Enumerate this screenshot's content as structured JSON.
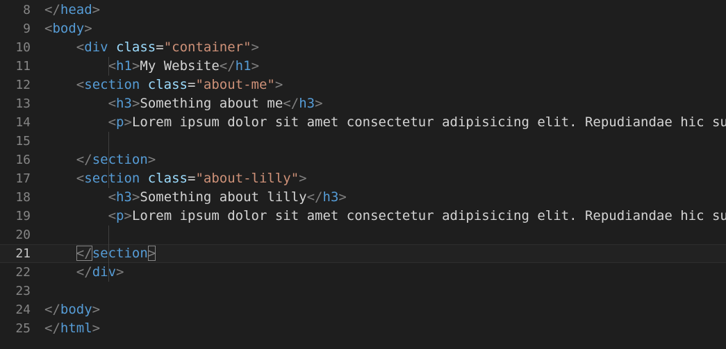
{
  "editor": {
    "language": "html",
    "current_line": 21,
    "colors": {
      "background": "#1e1e1e",
      "line_number": "#858585",
      "punctuation": "#808080",
      "tag": "#569cd6",
      "attribute": "#9cdcfe",
      "string": "#ce9178",
      "text": "#d4d4d4"
    },
    "lines": [
      {
        "n": "8",
        "indent": 0,
        "tokens": [
          {
            "t": "punct",
            "v": "</"
          },
          {
            "t": "tag",
            "v": "head"
          },
          {
            "t": "punct",
            "v": ">"
          }
        ]
      },
      {
        "n": "9",
        "indent": 0,
        "tokens": [
          {
            "t": "punct",
            "v": "<"
          },
          {
            "t": "tag",
            "v": "body"
          },
          {
            "t": "punct",
            "v": ">"
          }
        ]
      },
      {
        "n": "10",
        "indent": 4,
        "tokens": [
          {
            "t": "punct",
            "v": "<"
          },
          {
            "t": "tag",
            "v": "div"
          },
          {
            "t": "text",
            "v": " "
          },
          {
            "t": "attr",
            "v": "class"
          },
          {
            "t": "text",
            "v": "="
          },
          {
            "t": "str",
            "v": "\"container\""
          },
          {
            "t": "punct",
            "v": ">"
          }
        ]
      },
      {
        "n": "11",
        "indent": 8,
        "tokens": [
          {
            "t": "punct",
            "v": "<"
          },
          {
            "t": "tag",
            "v": "h1"
          },
          {
            "t": "punct",
            "v": ">"
          },
          {
            "t": "text",
            "v": "My Website"
          },
          {
            "t": "punct",
            "v": "</"
          },
          {
            "t": "tag",
            "v": "h1"
          },
          {
            "t": "punct",
            "v": ">"
          }
        ]
      },
      {
        "n": "12",
        "indent": 4,
        "tokens": [
          {
            "t": "punct",
            "v": "<"
          },
          {
            "t": "tag",
            "v": "section"
          },
          {
            "t": "text",
            "v": " "
          },
          {
            "t": "attr",
            "v": "class"
          },
          {
            "t": "text",
            "v": "="
          },
          {
            "t": "str",
            "v": "\"about-me\""
          },
          {
            "t": "punct",
            "v": ">"
          }
        ]
      },
      {
        "n": "13",
        "indent": 8,
        "tokens": [
          {
            "t": "punct",
            "v": "<"
          },
          {
            "t": "tag",
            "v": "h3"
          },
          {
            "t": "punct",
            "v": ">"
          },
          {
            "t": "text",
            "v": "Something about me"
          },
          {
            "t": "punct",
            "v": "</"
          },
          {
            "t": "tag",
            "v": "h3"
          },
          {
            "t": "punct",
            "v": ">"
          }
        ]
      },
      {
        "n": "14",
        "indent": 8,
        "tokens": [
          {
            "t": "punct",
            "v": "<"
          },
          {
            "t": "tag",
            "v": "p"
          },
          {
            "t": "punct",
            "v": ">"
          },
          {
            "t": "text",
            "v": "Lorem ipsum dolor sit amet consectetur adipisicing elit. Repudiandae hic sun"
          }
        ]
      },
      {
        "n": "15",
        "indent": 0,
        "tokens": []
      },
      {
        "n": "16",
        "indent": 4,
        "tokens": [
          {
            "t": "punct",
            "v": "</"
          },
          {
            "t": "tag",
            "v": "section"
          },
          {
            "t": "punct",
            "v": ">"
          }
        ]
      },
      {
        "n": "17",
        "indent": 4,
        "tokens": [
          {
            "t": "punct",
            "v": "<"
          },
          {
            "t": "tag",
            "v": "section"
          },
          {
            "t": "text",
            "v": " "
          },
          {
            "t": "attr",
            "v": "class"
          },
          {
            "t": "text",
            "v": "="
          },
          {
            "t": "str",
            "v": "\"about-lilly\""
          },
          {
            "t": "punct",
            "v": ">"
          }
        ]
      },
      {
        "n": "18",
        "indent": 8,
        "tokens": [
          {
            "t": "punct",
            "v": "<"
          },
          {
            "t": "tag",
            "v": "h3"
          },
          {
            "t": "punct",
            "v": ">"
          },
          {
            "t": "text",
            "v": "Something about lilly"
          },
          {
            "t": "punct",
            "v": "</"
          },
          {
            "t": "tag",
            "v": "h3"
          },
          {
            "t": "punct",
            "v": ">"
          }
        ]
      },
      {
        "n": "19",
        "indent": 8,
        "tokens": [
          {
            "t": "punct",
            "v": "<"
          },
          {
            "t": "tag",
            "v": "p"
          },
          {
            "t": "punct",
            "v": ">"
          },
          {
            "t": "text",
            "v": "Lorem ipsum dolor sit amet consectetur adipisicing elit. Repudiandae hic sun"
          }
        ]
      },
      {
        "n": "20",
        "indent": 0,
        "tokens": []
      },
      {
        "n": "21",
        "indent": 4,
        "tokens": [
          {
            "t": "punct",
            "v": "</",
            "bracket": true
          },
          {
            "t": "tag",
            "v": "section"
          },
          {
            "t": "punct",
            "v": ">",
            "bracket": true
          }
        ]
      },
      {
        "n": "22",
        "indent": 4,
        "tokens": [
          {
            "t": "punct",
            "v": "</"
          },
          {
            "t": "tag",
            "v": "div"
          },
          {
            "t": "punct",
            "v": ">"
          }
        ]
      },
      {
        "n": "23",
        "indent": 0,
        "tokens": []
      },
      {
        "n": "24",
        "indent": 0,
        "tokens": [
          {
            "t": "punct",
            "v": "</"
          },
          {
            "t": "tag",
            "v": "body"
          },
          {
            "t": "punct",
            "v": ">"
          }
        ]
      },
      {
        "n": "25",
        "indent": 0,
        "tokens": [
          {
            "t": "punct",
            "v": "</"
          },
          {
            "t": "tag",
            "v": "html"
          },
          {
            "t": "punct",
            "v": ">"
          }
        ]
      }
    ]
  }
}
